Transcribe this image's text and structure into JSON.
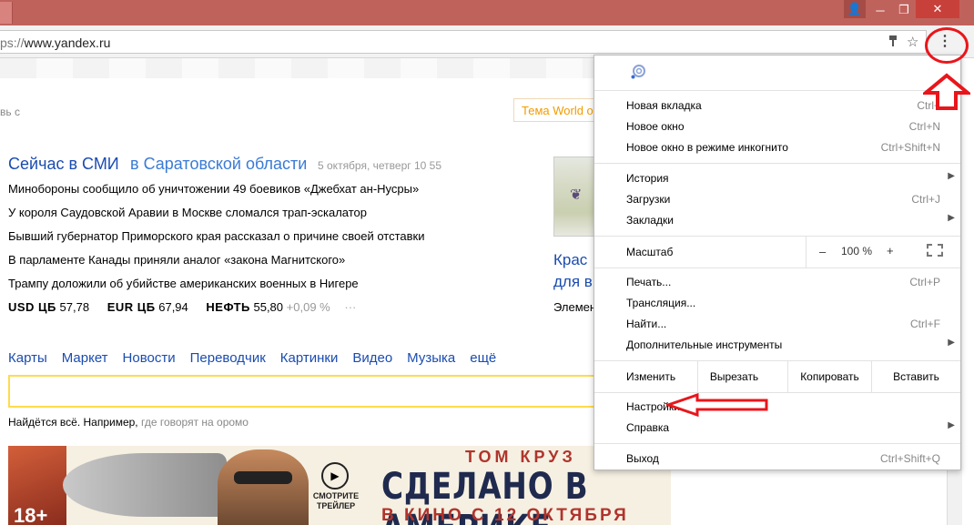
{
  "browser": {
    "url_scheme": "ps://",
    "url_host": "www.yandex.ru",
    "window_controls": {
      "user": "👤",
      "minimize": "─",
      "maximize": "❐",
      "close": "✕"
    },
    "menu_dots": "⋮"
  },
  "page": {
    "news_frag": "вь с",
    "theme_button": "Тема World o",
    "news": {
      "heading": "Сейчас в СМИ",
      "region": "в Саратовской области",
      "date": "5 октября, четверг 10 55",
      "items": [
        "Минобороны сообщило об уничтожении 49 боевиков «Джебхат ан-Нусры»",
        "У короля Саудовской Аравии в Москве сломался трап-эскалатор",
        "Бывший губернатор Приморского края рассказал о причине своей отставки",
        "В парламенте Канады приняли аналог «закона Магнитского»",
        "Трампу доложили об убийстве американских военных в Нигере"
      ]
    },
    "rates": {
      "usd_label": "USD ЦБ",
      "usd_value": "57,78",
      "eur_label": "EUR ЦБ",
      "eur_value": "67,94",
      "oil_label": "НЕФТЬ",
      "oil_value": "55,80",
      "oil_change": "+0,09 %",
      "more": "···"
    },
    "promo": {
      "line1": "Крас",
      "line2": "для в",
      "line3": "Элемен"
    },
    "services": [
      "Карты",
      "Маркет",
      "Новости",
      "Переводчик",
      "Картинки",
      "Видео",
      "Музыка",
      "ещё"
    ],
    "search_hint": {
      "text": "Найдётся всё. Например,",
      "example": "где говорят на оромо"
    },
    "banner": {
      "age": "18+",
      "watch": "СМОТРИТЕ ТРЕЙЛЕР",
      "actor": "ТОМ КРУЗ",
      "title": "СДЕЛАНО В АМЕРИКЕ",
      "date": "В КИНО С 12 ОКТЯБРЯ"
    }
  },
  "menu": {
    "new_tab": {
      "label": "Новая вкладка",
      "shortcut": "Ctrl+"
    },
    "new_window": {
      "label": "Новое окно",
      "shortcut": "Ctrl+N"
    },
    "incognito": {
      "label": "Новое окно в режиме инкогнито",
      "shortcut": "Ctrl+Shift+N"
    },
    "history": {
      "label": "История",
      "arrow": "▶"
    },
    "downloads": {
      "label": "Загрузки",
      "shortcut": "Ctrl+J"
    },
    "bookmarks": {
      "label": "Закладки",
      "arrow": "▶"
    },
    "zoom": {
      "label": "Масштаб",
      "minus": "–",
      "value": "100 %",
      "plus": "+"
    },
    "print": {
      "label": "Печать...",
      "shortcut": "Ctrl+P"
    },
    "cast": {
      "label": "Трансляция..."
    },
    "find": {
      "label": "Найти...",
      "shortcut": "Ctrl+F"
    },
    "more_tools": {
      "label": "Дополнительные инструменты",
      "arrow": "▶"
    },
    "edit": {
      "label": "Изменить",
      "cut": "Вырезать",
      "copy": "Копировать",
      "paste": "Вставить"
    },
    "settings": {
      "label": "Настройки"
    },
    "help": {
      "label": "Справка",
      "arrow": "▶"
    },
    "exit": {
      "label": "Выход",
      "shortcut": "Ctrl+Shift+Q"
    }
  },
  "colors": {
    "annotation": "#e8161b",
    "titlebar": "#c0625c",
    "link": "#1a4cb0",
    "accent_yellow": "#ffdb4d"
  }
}
